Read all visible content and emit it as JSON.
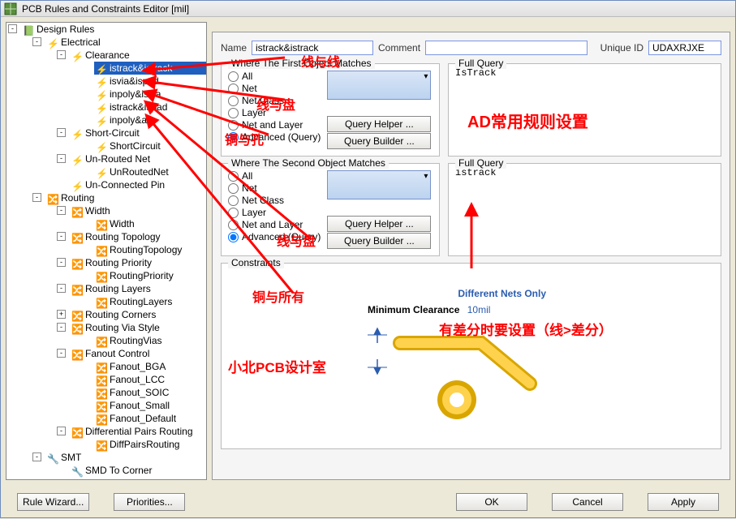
{
  "window": {
    "title": "PCB Rules and Constraints Editor [mil]"
  },
  "tree": {
    "root": "Design Rules",
    "electrical": "Electrical",
    "clearance": "Clearance",
    "clr_items": [
      "istrack&istrack",
      "isvia&ispad",
      "inpoly&isvia",
      "istrack&ispad",
      "inpoly&all"
    ],
    "short": "Short-Circuit",
    "short_items": [
      "ShortCircuit"
    ],
    "unrouted": "Un-Routed Net",
    "unrouted_items": [
      "UnRoutedNet"
    ],
    "unconn": "Un-Connected Pin",
    "routing": "Routing",
    "width": "Width",
    "width_items": [
      "Width"
    ],
    "rtopo": "Routing Topology",
    "rtopo_items": [
      "RoutingTopology"
    ],
    "rprio": "Routing Priority",
    "rprio_items": [
      "RoutingPriority"
    ],
    "rlayers": "Routing Layers",
    "rlayers_items": [
      "RoutingLayers"
    ],
    "rcorners": "Routing Corners",
    "rvia": "Routing Via Style",
    "rvia_items": [
      "RoutingVias"
    ],
    "fanout": "Fanout Control",
    "fanout_items": [
      "Fanout_BGA",
      "Fanout_LCC",
      "Fanout_SOIC",
      "Fanout_Small",
      "Fanout_Default"
    ],
    "diffpair": "Differential Pairs Routing",
    "diffpair_items": [
      "DiffPairsRouting"
    ],
    "smt": "SMT",
    "smt_items": [
      "SMD To Corner"
    ]
  },
  "fields": {
    "name_label": "Name",
    "name_value": "istrack&istrack",
    "comment_label": "Comment",
    "comment_value": "",
    "uid_label": "Unique ID",
    "uid_value": "UDAXRJXE"
  },
  "group1": {
    "legend": "Where The First Object Matches",
    "opts": [
      "All",
      "Net",
      "Net Class",
      "Layer",
      "Net and Layer",
      "Advanced (Query)"
    ],
    "selected": 5,
    "btn_helper": "Query Helper ...",
    "btn_builder": "Query Builder ..."
  },
  "group2": {
    "legend": "Where The Second Object Matches",
    "opts": [
      "All",
      "Net",
      "Net Class",
      "Layer",
      "Net and Layer",
      "Advanced (Query)"
    ],
    "selected": 5,
    "btn_helper": "Query Helper ...",
    "btn_builder": "Query Builder ..."
  },
  "fullquery": {
    "legend": "Full Query",
    "value1": "IsTrack",
    "value2": "istrack"
  },
  "constraints": {
    "legend": "Constraints",
    "diffnets": "Different Nets Only",
    "minclr": "Minimum Clearance",
    "minclr_val": "10mil"
  },
  "annotations": {
    "a1": "线与线",
    "a2": "线与盘",
    "a3": "铜与孔",
    "a4": "线与盘",
    "a5": "铜与所有",
    "title": "AD常用规则设置",
    "diff": "有差分时要设置（线>差分）",
    "studio": "小北PCB设计室"
  },
  "footer": {
    "rulewizard": "Rule Wizard...",
    "priorities": "Priorities...",
    "ok": "OK",
    "cancel": "Cancel",
    "apply": "Apply"
  }
}
